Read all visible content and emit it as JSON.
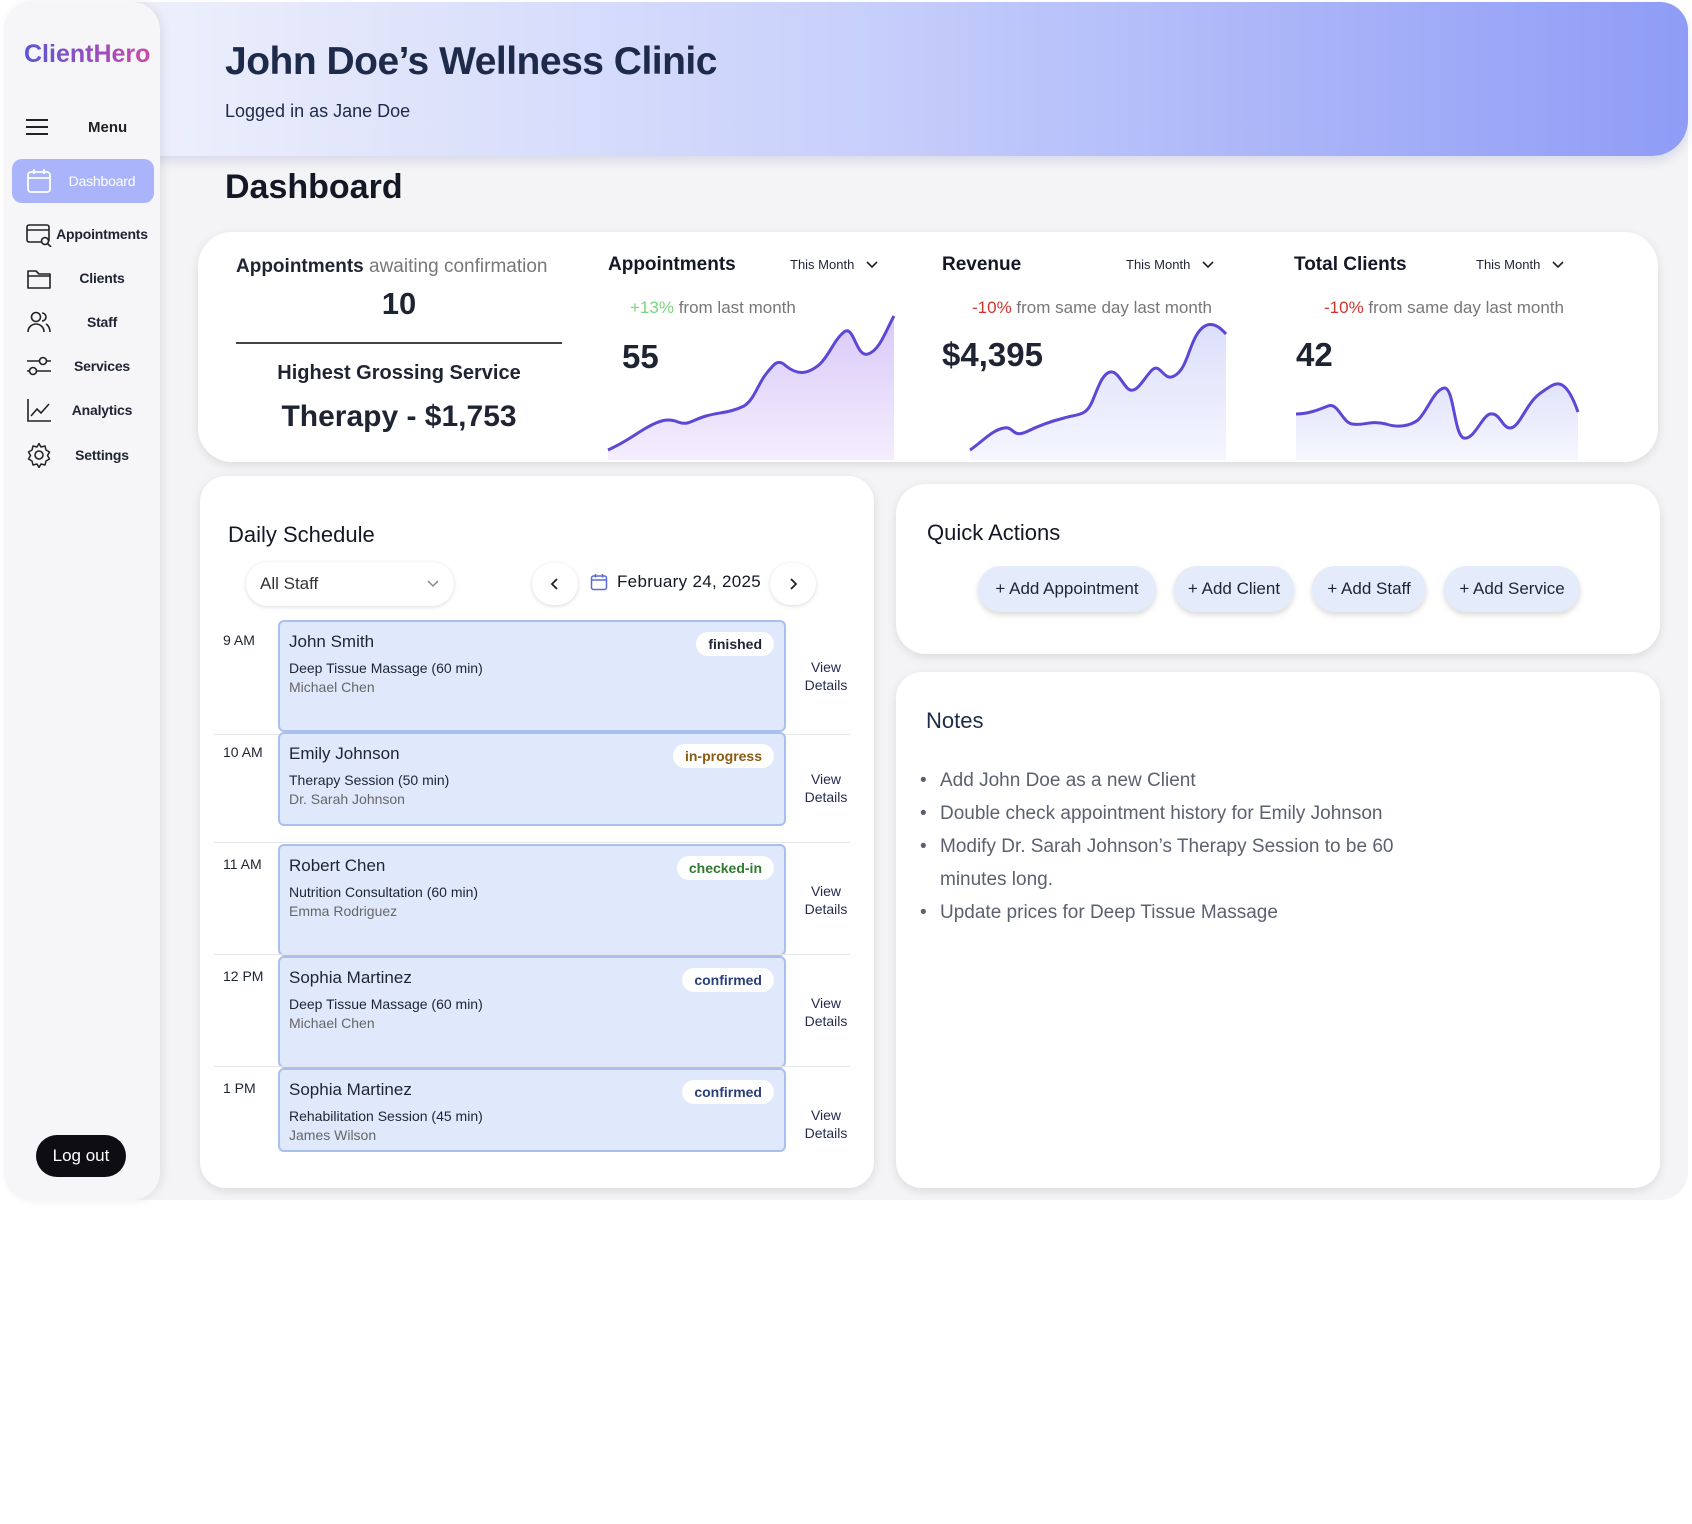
{
  "brand": "ClientHero",
  "sidebar": {
    "menu_label": "Menu",
    "items": [
      {
        "label": "Dashboard",
        "icon": "calendar-icon",
        "active": true
      },
      {
        "label": "Appointments",
        "icon": "appointments-icon"
      },
      {
        "label": "Clients",
        "icon": "folder-icon"
      },
      {
        "label": "Staff",
        "icon": "users-icon"
      },
      {
        "label": "Services",
        "icon": "sliders-icon"
      },
      {
        "label": "Analytics",
        "icon": "chart-line-icon"
      },
      {
        "label": "Settings",
        "icon": "gear-icon"
      }
    ],
    "logout_label": "Log out"
  },
  "header": {
    "title": "John Doe’s Wellness Clinic",
    "logged_in": "Logged in as Jane Doe"
  },
  "page_title": "Dashboard",
  "stats": {
    "awaiting": {
      "label_bold": "Appointments",
      "label_rest": "awaiting confirmation",
      "value": "10"
    },
    "highest": {
      "label": "Highest Grossing Service",
      "value": "Therapy - $1,753"
    },
    "appointments": {
      "title": "Appointments",
      "period": "This Month",
      "change": "+13%",
      "change_text": "from last month",
      "value": "55"
    },
    "revenue": {
      "title": "Revenue",
      "period": "This Month",
      "change": "-10%",
      "change_text": "from same day last month",
      "value": "$4,395"
    },
    "clients": {
      "title": "Total Clients",
      "period": "This Month",
      "change": "-10%",
      "change_text": "from same day last month",
      "value": "42"
    }
  },
  "schedule": {
    "title": "Daily Schedule",
    "staff_filter": "All Staff",
    "date": "February 24, 2025",
    "view_label_1": "View",
    "view_label_2": "Details",
    "slots": [
      {
        "time": "9 AM",
        "client": "John Smith",
        "service": "Deep Tissue Massage (60 min)",
        "staff": "Michael Chen",
        "status": "finished"
      },
      {
        "time": "10 AM",
        "client": "Emily Johnson",
        "service": "Therapy Session (50 min)",
        "staff": "Dr. Sarah Johnson",
        "status": "in-progress"
      },
      {
        "time": "11 AM",
        "client": "Robert Chen",
        "service": "Nutrition Consultation (60 min)",
        "staff": "Emma Rodriguez",
        "status": "checked-in"
      },
      {
        "time": "12 PM",
        "client": "Sophia Martinez",
        "service": "Deep Tissue Massage (60 min)",
        "staff": "Michael Chen",
        "status": "confirmed"
      },
      {
        "time": "1 PM",
        "client": "Sophia Martinez",
        "service": "Rehabilitation Session (45 min)",
        "staff": "James Wilson",
        "status": "confirmed"
      }
    ]
  },
  "quick_actions": {
    "title": "Quick Actions",
    "buttons": [
      "+ Add Appointment",
      "+ Add Client",
      "+ Add Staff",
      "+ Add Service"
    ]
  },
  "notes": {
    "title": "Notes",
    "items": [
      "Add John Doe as a new Client",
      "Double check appointment history for Emily Johnson",
      "Modify Dr. Sarah Johnson’s Therapy Session to be 60 minutes long.",
      "Update prices for Deep Tissue Massage"
    ]
  },
  "colors": {
    "accent": "#a9b4fb",
    "positive": "#7ed47f",
    "negative": "#d0342c",
    "badge_finished": "#1f2433",
    "badge_in_progress": "#8a5a12",
    "badge_checked_in": "#2f7a2f",
    "badge_confirmed": "#2a3f7a"
  }
}
